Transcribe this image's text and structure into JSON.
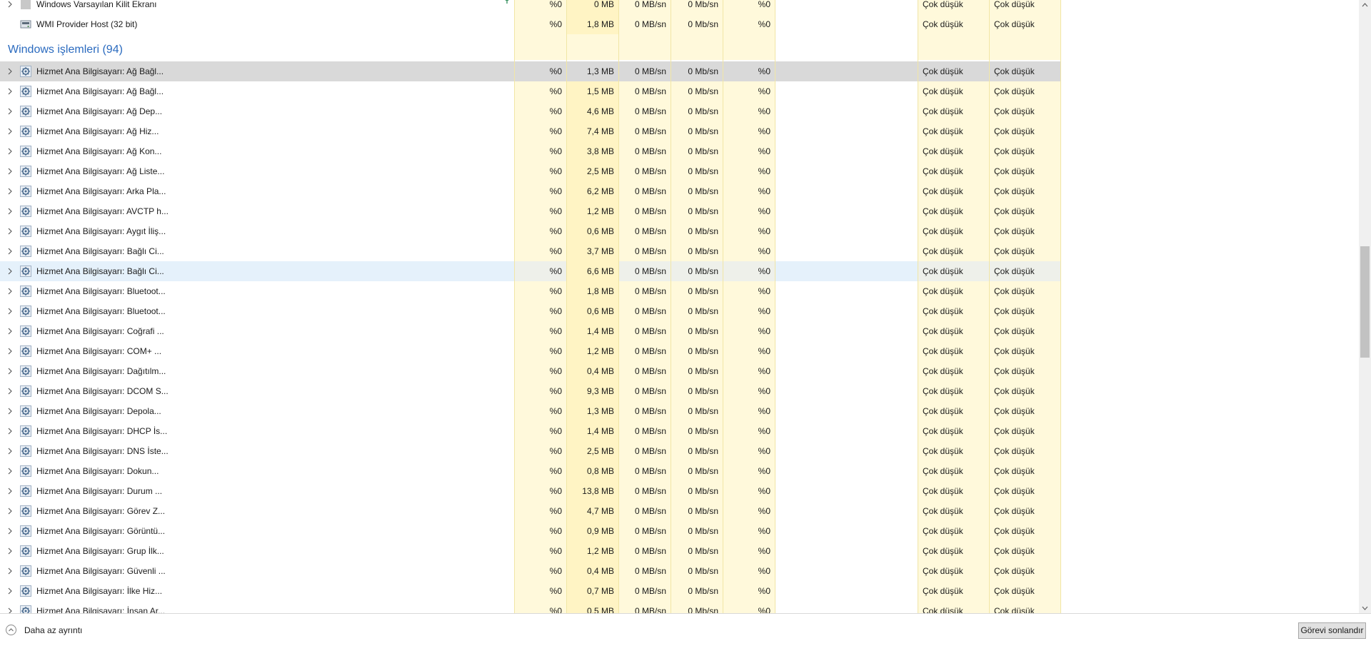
{
  "top_rows": [
    {
      "name": "Windows Varsayılan Kilit Ekranı",
      "cpu": "%0",
      "memory": "0 MB",
      "disk": "0 MB/sn",
      "network": "0 Mb/sn",
      "gpu": "%0",
      "power": "Çok düşük",
      "power_trend": "Çok düşük",
      "icon": "blank-app-icon",
      "expander": true,
      "suspended_leaf": true
    },
    {
      "name": "WMI Provider Host (32 bit)",
      "cpu": "%0",
      "memory": "1,8 MB",
      "disk": "0 MB/sn",
      "network": "0 Mb/sn",
      "gpu": "%0",
      "power": "Çok düşük",
      "power_trend": "Çok düşük",
      "icon": "wmi-app-icon",
      "expander": false
    }
  ],
  "group": {
    "title": "Windows işlemleri (94)"
  },
  "rows": [
    {
      "name": "Hizmet Ana Bilgisayarı: Ağ Bağl...",
      "cpu": "%0",
      "memory": "1,3 MB",
      "disk": "0 MB/sn",
      "network": "0 Mb/sn",
      "gpu": "%0",
      "power": "Çok düşük",
      "power_trend": "Çok düşük",
      "state": "selected"
    },
    {
      "name": "Hizmet Ana Bilgisayarı: Ağ Bağl...",
      "cpu": "%0",
      "memory": "1,5 MB",
      "disk": "0 MB/sn",
      "network": "0 Mb/sn",
      "gpu": "%0",
      "power": "Çok düşük",
      "power_trend": "Çok düşük"
    },
    {
      "name": "Hizmet Ana Bilgisayarı: Ağ Dep...",
      "cpu": "%0",
      "memory": "4,6 MB",
      "disk": "0 MB/sn",
      "network": "0 Mb/sn",
      "gpu": "%0",
      "power": "Çok düşük",
      "power_trend": "Çok düşük"
    },
    {
      "name": "Hizmet Ana Bilgisayarı: Ağ Hiz...",
      "cpu": "%0",
      "memory": "7,4 MB",
      "disk": "0 MB/sn",
      "network": "0 Mb/sn",
      "gpu": "%0",
      "power": "Çok düşük",
      "power_trend": "Çok düşük"
    },
    {
      "name": "Hizmet Ana Bilgisayarı: Ağ Kon...",
      "cpu": "%0",
      "memory": "3,8 MB",
      "disk": "0 MB/sn",
      "network": "0 Mb/sn",
      "gpu": "%0",
      "power": "Çok düşük",
      "power_trend": "Çok düşük"
    },
    {
      "name": "Hizmet Ana Bilgisayarı: Ağ Liste...",
      "cpu": "%0",
      "memory": "2,5 MB",
      "disk": "0 MB/sn",
      "network": "0 Mb/sn",
      "gpu": "%0",
      "power": "Çok düşük",
      "power_trend": "Çok düşük"
    },
    {
      "name": "Hizmet Ana Bilgisayarı: Arka Pla...",
      "cpu": "%0",
      "memory": "6,2 MB",
      "disk": "0 MB/sn",
      "network": "0 Mb/sn",
      "gpu": "%0",
      "power": "Çok düşük",
      "power_trend": "Çok düşük"
    },
    {
      "name": "Hizmet Ana Bilgisayarı: AVCTP h...",
      "cpu": "%0",
      "memory": "1,2 MB",
      "disk": "0 MB/sn",
      "network": "0 Mb/sn",
      "gpu": "%0",
      "power": "Çok düşük",
      "power_trend": "Çok düşük"
    },
    {
      "name": "Hizmet Ana Bilgisayarı: Aygıt İliş...",
      "cpu": "%0",
      "memory": "0,6 MB",
      "disk": "0 MB/sn",
      "network": "0 Mb/sn",
      "gpu": "%0",
      "power": "Çok düşük",
      "power_trend": "Çok düşük"
    },
    {
      "name": "Hizmet Ana Bilgisayarı: Bağlı Ci...",
      "cpu": "%0",
      "memory": "3,7 MB",
      "disk": "0 MB/sn",
      "network": "0 Mb/sn",
      "gpu": "%0",
      "power": "Çok düşük",
      "power_trend": "Çok düşük"
    },
    {
      "name": "Hizmet Ana Bilgisayarı: Bağlı Ci...",
      "cpu": "%0",
      "memory": "6,6 MB",
      "disk": "0 MB/sn",
      "network": "0 Mb/sn",
      "gpu": "%0",
      "power": "Çok düşük",
      "power_trend": "Çok düşük",
      "state": "hover"
    },
    {
      "name": "Hizmet Ana Bilgisayarı: Bluetoot...",
      "cpu": "%0",
      "memory": "1,8 MB",
      "disk": "0 MB/sn",
      "network": "0 Mb/sn",
      "gpu": "%0",
      "power": "Çok düşük",
      "power_trend": "Çok düşük"
    },
    {
      "name": "Hizmet Ana Bilgisayarı: Bluetoot...",
      "cpu": "%0",
      "memory": "0,6 MB",
      "disk": "0 MB/sn",
      "network": "0 Mb/sn",
      "gpu": "%0",
      "power": "Çok düşük",
      "power_trend": "Çok düşük"
    },
    {
      "name": "Hizmet Ana Bilgisayarı: Coğrafi ...",
      "cpu": "%0",
      "memory": "1,4 MB",
      "disk": "0 MB/sn",
      "network": "0 Mb/sn",
      "gpu": "%0",
      "power": "Çok düşük",
      "power_trend": "Çok düşük"
    },
    {
      "name": "Hizmet Ana Bilgisayarı: COM+ ...",
      "cpu": "%0",
      "memory": "1,2 MB",
      "disk": "0 MB/sn",
      "network": "0 Mb/sn",
      "gpu": "%0",
      "power": "Çok düşük",
      "power_trend": "Çok düşük"
    },
    {
      "name": "Hizmet Ana Bilgisayarı: Dağıtılm...",
      "cpu": "%0",
      "memory": "0,4 MB",
      "disk": "0 MB/sn",
      "network": "0 Mb/sn",
      "gpu": "%0",
      "power": "Çok düşük",
      "power_trend": "Çok düşük"
    },
    {
      "name": "Hizmet Ana Bilgisayarı: DCOM S...",
      "cpu": "%0",
      "memory": "9,3 MB",
      "disk": "0 MB/sn",
      "network": "0 Mb/sn",
      "gpu": "%0",
      "power": "Çok düşük",
      "power_trend": "Çok düşük"
    },
    {
      "name": "Hizmet Ana Bilgisayarı: Depola...",
      "cpu": "%0",
      "memory": "1,3 MB",
      "disk": "0 MB/sn",
      "network": "0 Mb/sn",
      "gpu": "%0",
      "power": "Çok düşük",
      "power_trend": "Çok düşük"
    },
    {
      "name": "Hizmet Ana Bilgisayarı: DHCP İs...",
      "cpu": "%0",
      "memory": "1,4 MB",
      "disk": "0 MB/sn",
      "network": "0 Mb/sn",
      "gpu": "%0",
      "power": "Çok düşük",
      "power_trend": "Çok düşük"
    },
    {
      "name": "Hizmet Ana Bilgisayarı: DNS İste...",
      "cpu": "%0",
      "memory": "2,5 MB",
      "disk": "0 MB/sn",
      "network": "0 Mb/sn",
      "gpu": "%0",
      "power": "Çok düşük",
      "power_trend": "Çok düşük"
    },
    {
      "name": "Hizmet Ana Bilgisayarı: Dokun...",
      "cpu": "%0",
      "memory": "0,8 MB",
      "disk": "0 MB/sn",
      "network": "0 Mb/sn",
      "gpu": "%0",
      "power": "Çok düşük",
      "power_trend": "Çok düşük"
    },
    {
      "name": "Hizmet Ana Bilgisayarı: Durum ...",
      "cpu": "%0",
      "memory": "13,8 MB",
      "disk": "0 MB/sn",
      "network": "0 Mb/sn",
      "gpu": "%0",
      "power": "Çok düşük",
      "power_trend": "Çok düşük"
    },
    {
      "name": "Hizmet Ana Bilgisayarı: Görev Z...",
      "cpu": "%0",
      "memory": "4,7 MB",
      "disk": "0 MB/sn",
      "network": "0 Mb/sn",
      "gpu": "%0",
      "power": "Çok düşük",
      "power_trend": "Çok düşük"
    },
    {
      "name": "Hizmet Ana Bilgisayarı: Görüntü...",
      "cpu": "%0",
      "memory": "0,9 MB",
      "disk": "0 MB/sn",
      "network": "0 Mb/sn",
      "gpu": "%0",
      "power": "Çok düşük",
      "power_trend": "Çok düşük"
    },
    {
      "name": "Hizmet Ana Bilgisayarı: Grup İlk...",
      "cpu": "%0",
      "memory": "1,2 MB",
      "disk": "0 MB/sn",
      "network": "0 Mb/sn",
      "gpu": "%0",
      "power": "Çok düşük",
      "power_trend": "Çok düşük"
    },
    {
      "name": "Hizmet Ana Bilgisayarı: Güvenli ...",
      "cpu": "%0",
      "memory": "0,4 MB",
      "disk": "0 MB/sn",
      "network": "0 Mb/sn",
      "gpu": "%0",
      "power": "Çok düşük",
      "power_trend": "Çok düşük"
    },
    {
      "name": "Hizmet Ana Bilgisayarı: İlke Hiz...",
      "cpu": "%0",
      "memory": "0,7 MB",
      "disk": "0 MB/sn",
      "network": "0 Mb/sn",
      "gpu": "%0",
      "power": "Çok düşük",
      "power_trend": "Çok düşük"
    },
    {
      "name": "Hizmet Ana Bilgisayarı: İnsan Ar...",
      "cpu": "%0",
      "memory": "0,5 MB",
      "disk": "0 MB/sn",
      "network": "0 Mb/sn",
      "gpu": "%0",
      "power": "Çok düşük",
      "power_trend": "Çok düşük"
    }
  ],
  "row_icon": "service-gear-icon",
  "footer": {
    "less_details": "Daha az ayrıntı",
    "end_task": "Görevi sonlandır"
  },
  "colors": {
    "group_title": "#2b6bbf",
    "heat_light": "#fff9db",
    "heat_medium": "#fff4c4",
    "selected": "#d9d9d9",
    "hover": "#e5f1fb"
  }
}
